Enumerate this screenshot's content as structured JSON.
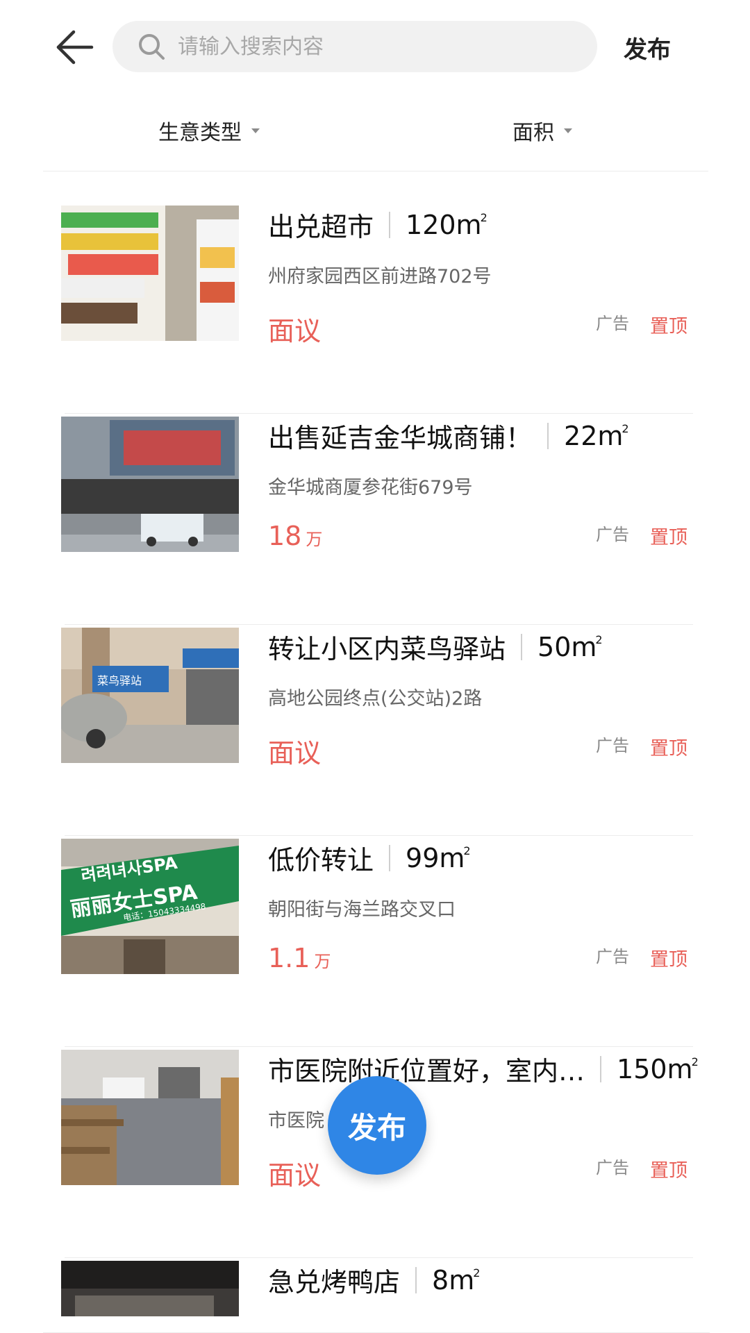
{
  "header": {
    "search_placeholder": "请输入搜索内容",
    "publish_label": "发布"
  },
  "filters": {
    "business_type": "生意类型",
    "area": "面积"
  },
  "listings": [
    {
      "title": "出兑超市",
      "area": "120m",
      "area_sup": "2",
      "address": "州府家园西区前进路702号",
      "price": "面议",
      "price_unit": "",
      "ad": "广告",
      "pin": "置顶"
    },
    {
      "title": "出售延吉金华城商铺！",
      "area": "22m",
      "area_sup": "2",
      "address": "金华城商厦参花街679号",
      "price": "18",
      "price_unit": "万",
      "ad": "广告",
      "pin": "置顶"
    },
    {
      "title": "转让小区内菜鸟驿站",
      "area": "50m",
      "area_sup": "2",
      "address": "高地公园终点(公交站)2路",
      "price": "面议",
      "price_unit": "",
      "ad": "广告",
      "pin": "置顶"
    },
    {
      "title": "低价转让",
      "area": "99m",
      "area_sup": "2",
      "address": "朝阳街与海兰路交叉口",
      "price": "1.1",
      "price_unit": "万",
      "ad": "广告",
      "pin": "置顶"
    },
    {
      "title": "市医院附近位置好，室内…",
      "area": "150m",
      "area_sup": "2",
      "address": "市医院",
      "price": "面议",
      "price_unit": "",
      "ad": "广告",
      "pin": "置顶"
    },
    {
      "title": "急兑烤鸭店",
      "area": "8m",
      "area_sup": "2",
      "address": "",
      "price": "",
      "price_unit": "",
      "ad": "",
      "pin": ""
    }
  ],
  "thumb_signs": {
    "spa_top": "려려녀사SPA",
    "spa_main": "丽丽女士SPA",
    "spa_phone": "电话：15043334498",
    "cainiao": "菜鸟驿站"
  },
  "fab_label": "发布",
  "colors": {
    "accent_red": "#e86058",
    "fab_blue": "#2f86e6",
    "search_bg": "#f1f1f1"
  },
  "icons": {
    "back": "back-arrow-icon",
    "search": "search-icon",
    "caret": "caret-down-icon"
  }
}
